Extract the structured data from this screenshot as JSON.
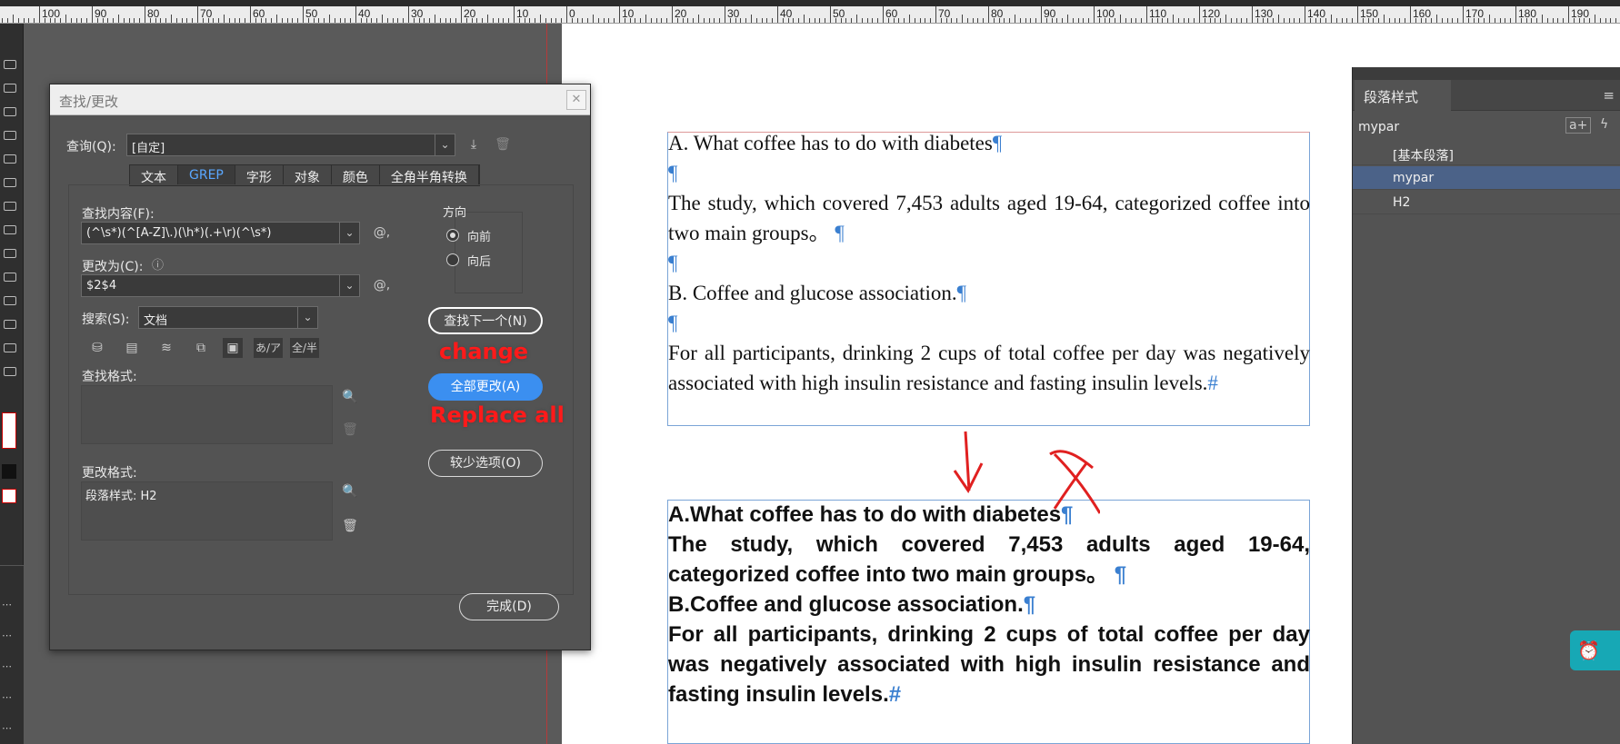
{
  "ruler": {
    "labels": [
      "100",
      "90",
      "80",
      "70",
      "60",
      "50",
      "40",
      "30",
      "20",
      "10",
      "0",
      "10",
      "20",
      "30",
      "40",
      "50",
      "60",
      "70",
      "80",
      "90",
      "100",
      "110",
      "120",
      "130",
      "140",
      "150",
      "160",
      "170",
      "180",
      "190"
    ]
  },
  "dialog": {
    "title": "查找/更改",
    "query_label": "查询(Q):",
    "query_value": "[自定]",
    "tabs": [
      "文本",
      "GREP",
      "字形",
      "对象",
      "颜色",
      "全角半角转换"
    ],
    "active_tab": "GREP",
    "find_label": "查找内容(F):",
    "find_value": "(^\\s*)(^[A-Z]\\.)(\\h*)(.+\\r)(^\\s*)",
    "change_label": "更改为(C):",
    "change_value": "$2$4",
    "search_label": "搜索(S):",
    "search_value": "文档",
    "find_format_label": "查找格式:",
    "change_format_label": "更改格式:",
    "change_format_value": "段落样式: H2",
    "direction_label": "方向",
    "direction_forward": "向前",
    "direction_backward": "向后",
    "find_next_button": "查找下一个(N)",
    "change_all_button": "全部更改(A)",
    "fewer_options_button": "较少选项(O)",
    "done_button": "完成(D)",
    "annotation_change": "change",
    "annotation_replace_all": "Replace all",
    "option_icons": [
      "あ/ア",
      "全/半"
    ]
  },
  "document": {
    "before": [
      "A. What coffee has to do with diabetes",
      "",
      "The study, which covered 7,453 adults aged 19-64, categorized coffee into two main groups。",
      "",
      "B. Coffee and glucose association.",
      "",
      "For all participants, drinking 2 cups of total coffee per day was negatively associated with high insulin resistance and fasting insulin levels."
    ],
    "after": [
      "A.What coffee has to do with diabetes",
      "The study, which covered 7,453 adults aged 19-64, categorized coffee into two main groups。",
      "B.Coffee and glucose association.",
      "For all participants, drinking 2 cups of total coffee per day was negatively associated with high insulin resistance and fasting insulin levels."
    ],
    "pilcrow": "¶",
    "end_mark": "#"
  },
  "paragraph_panel": {
    "title": "段落样式",
    "current": "mypar",
    "items": [
      "[基本段落]",
      "mypar",
      "H2"
    ],
    "selected": "mypar"
  },
  "colors": {
    "accent": "#3b8ff0",
    "annotation": "#ff1a1a",
    "selection": "#4b6288"
  }
}
